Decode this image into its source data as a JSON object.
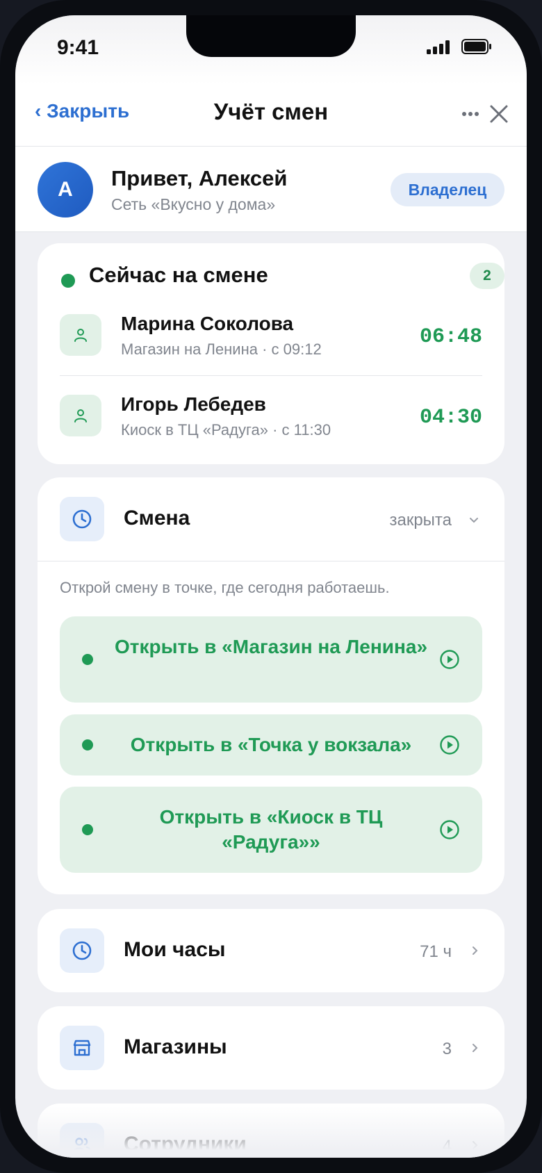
{
  "status_bar": {
    "time": "9:41"
  },
  "nav": {
    "back_label": "‹ Закрыть",
    "title": "Учёт смен"
  },
  "profile": {
    "avatar_letter": "А",
    "greeting": "Привет, Алексей",
    "org": "Сеть «Вкусно у дома»",
    "role": "Владелец"
  },
  "on_shift": {
    "title": "Сейчас на смене",
    "count": "2",
    "employees": [
      {
        "name": "Марина Соколова",
        "sub": "Магазин на Ленина · с 09:12",
        "elapsed": "06:48"
      },
      {
        "name": "Игорь Лебедев",
        "sub": "Киоск в ТЦ «Радуга» · с 11:30",
        "elapsed": "04:30"
      }
    ]
  },
  "shift": {
    "title": "Смена",
    "status": "закрыта",
    "hint": "Открой смену в точке, где сегодня работаешь.",
    "buttons": [
      {
        "label": "Открыть в «Магазин на Ленина»"
      },
      {
        "label": "Открыть в «Точка у вокзала»"
      },
      {
        "label": "Открыть в «Киоск в ТЦ «Радуга»»"
      }
    ]
  },
  "menu": [
    {
      "title": "Мои часы",
      "value": "71 ч",
      "icon": "clock-icon"
    },
    {
      "title": "Магазины",
      "value": "3",
      "icon": "store-icon"
    },
    {
      "title": "Сотрудники",
      "value": "4",
      "icon": "people-icon"
    }
  ],
  "colors": {
    "accent_blue": "#2d6fd1",
    "accent_green": "#1f9a55",
    "background": "#eff0f4"
  }
}
